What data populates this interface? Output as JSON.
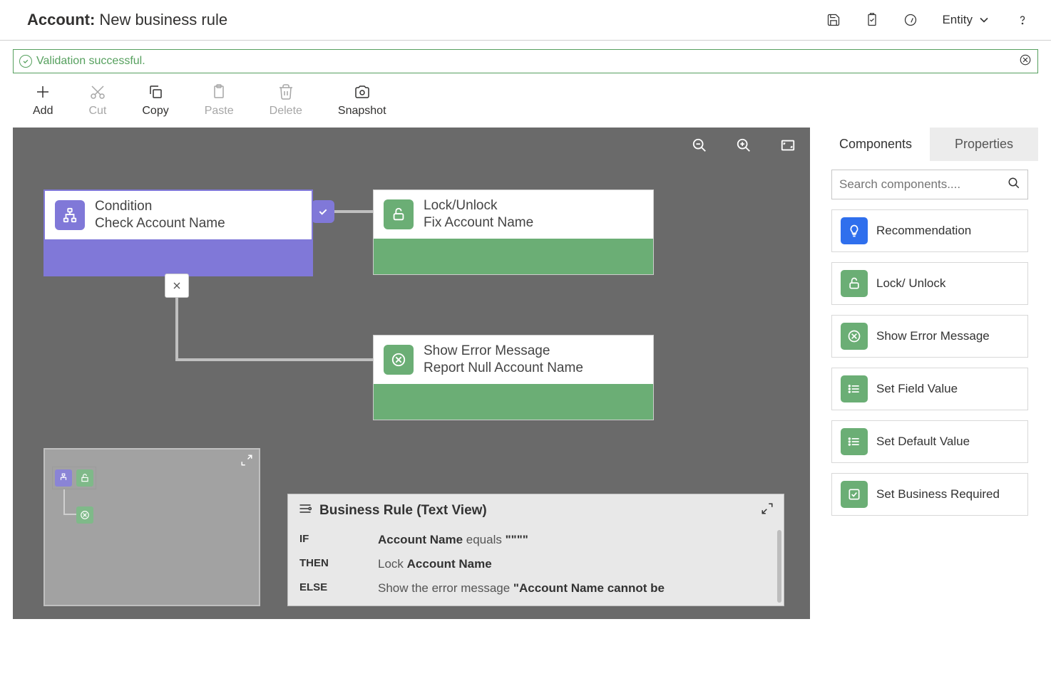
{
  "header": {
    "title_prefix": "Account:",
    "title_name": "New business rule",
    "entity_label": "Entity"
  },
  "validation": {
    "message": "Validation successful."
  },
  "toolbar": {
    "add": "Add",
    "cut": "Cut",
    "copy": "Copy",
    "paste": "Paste",
    "delete": "Delete",
    "snapshot": "Snapshot"
  },
  "nodes": {
    "condition": {
      "title": "Condition",
      "subtitle": "Check Account Name"
    },
    "lock": {
      "title": "Lock/Unlock",
      "subtitle": "Fix Account Name"
    },
    "error": {
      "title": "Show Error Message",
      "subtitle": "Report Null Account Name"
    }
  },
  "textview": {
    "heading": "Business Rule (Text View)",
    "if_kw": "IF",
    "if_html": "<b>Account Name</b> equals <b>\"\"\"\"</b>",
    "then_kw": "THEN",
    "then_html": "Lock <b>Account Name</b>",
    "else_kw": "ELSE",
    "else_html": "Show the error message <b>\"Account Name cannot be</b>"
  },
  "panel": {
    "tab_components": "Components",
    "tab_properties": "Properties",
    "search_placeholder": "Search components....",
    "items": {
      "recommendation": "Recommendation",
      "lock": "Lock/ Unlock",
      "error": "Show Error Message",
      "setfield": "Set Field Value",
      "setdefault": "Set Default Value",
      "setreq": "Set Business Required"
    }
  }
}
